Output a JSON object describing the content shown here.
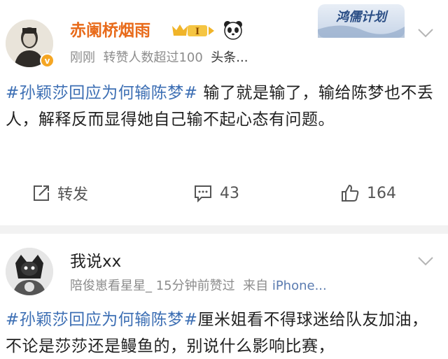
{
  "posts": [
    {
      "username": "赤阑桥烟雨",
      "meta_time": "刚刚",
      "meta_repost": "转赞人数超过100",
      "meta_source": "头条...",
      "badge_level": "I",
      "verified_mark": "v",
      "text_tag": "#孙颖莎回应为何输陈梦#",
      "text_body": " 输了就是输了，输给陈梦也不丢人，解释反而显得她自己输不起心态有问题。",
      "actions": {
        "repost_label": "转发",
        "comment_count": "43",
        "like_count": "164"
      }
    },
    {
      "username": "我说xx",
      "meta_liked": "陪俊崽看星星_ 15分钟前赞过",
      "meta_from": "来自",
      "meta_device": "iPhone...",
      "text_tag": "#孙颖莎回应为何输陈梦#",
      "text_body": "厘米姐看不得球迷给队友加油，不论是莎莎还是鳗鱼的，别说什么影响比赛，"
    }
  ],
  "logo_text": "鸿儒计划",
  "colors": {
    "username_accent": "#e86b1b",
    "hashtag": "#3d6fb4",
    "meta_gray": "#8c8c8c",
    "divider": "#f2f2f2",
    "verified": "#f5a623"
  },
  "icons": [
    "verified-badge-icon",
    "crown-level-icon",
    "panda-icon",
    "chevron-down-icon",
    "repost-icon",
    "comment-icon",
    "like-icon"
  ]
}
